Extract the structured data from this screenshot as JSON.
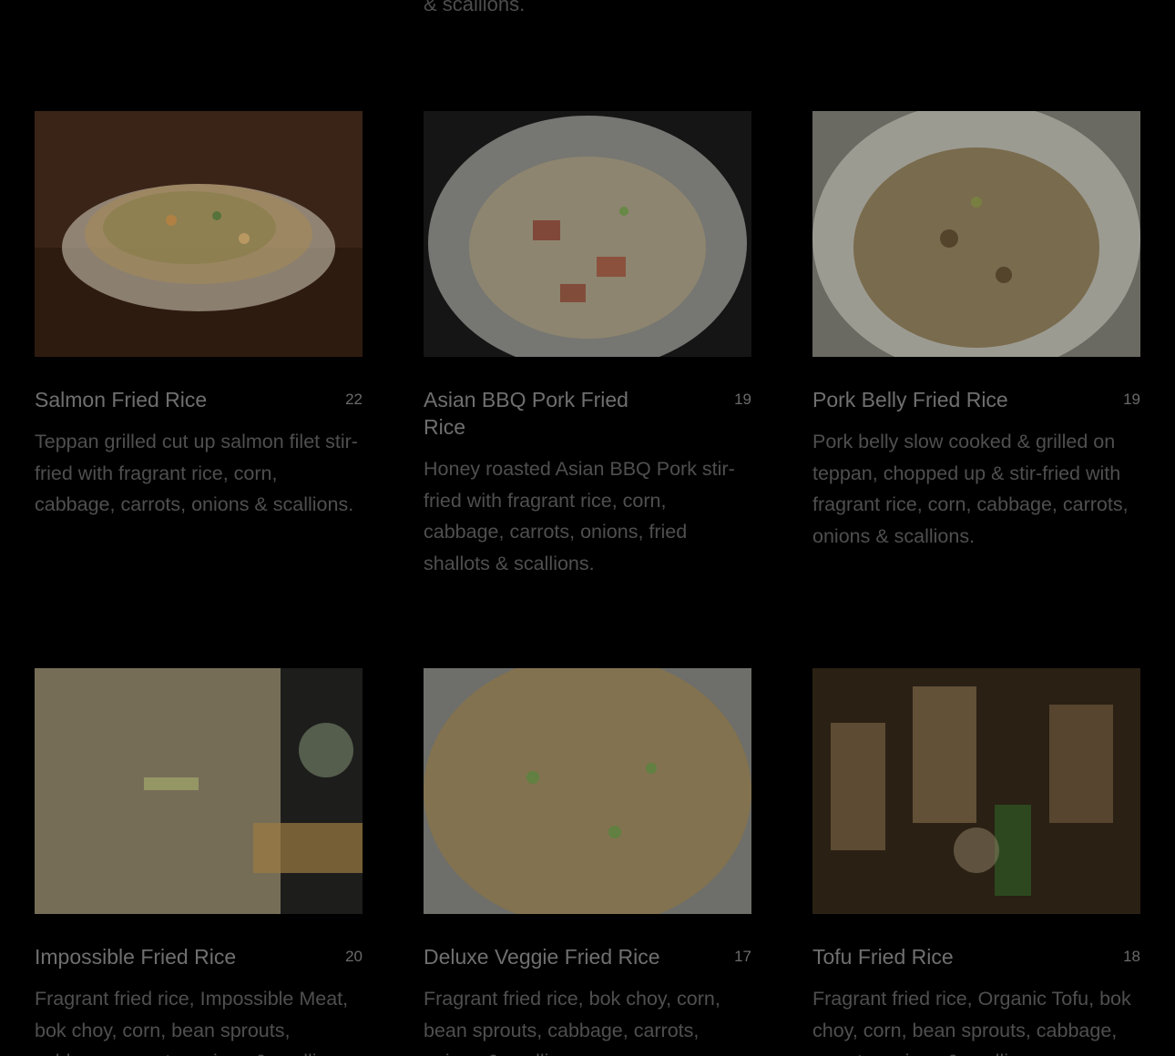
{
  "top_fragment": "& scallions.",
  "items": [
    {
      "name": "Salmon Fried Rice",
      "price": "22",
      "description": "Teppan grilled cut up salmon filet stir-fried with fragrant rice, corn, cabbage, carrots, onions & scallions."
    },
    {
      "name": "Asian BBQ Pork Fried Rice",
      "price": "19",
      "description": "Honey roasted Asian BBQ Pork stir-fried with fragrant rice, corn, cabbage, carrots, onions, fried shallots & scallions."
    },
    {
      "name": "Pork Belly Fried Rice",
      "price": "19",
      "description": "Pork belly slow cooked & grilled on teppan, chopped up & stir-fried with fragrant rice, corn, cabbage, carrots, onions & scallions."
    },
    {
      "name": "Impossible Fried Rice",
      "price": "20",
      "description": "Fragrant fried rice, Impossible Meat, bok choy, corn, bean sprouts, cabbage, carrots, onions & scallions."
    },
    {
      "name": "Deluxe Veggie Fried Rice",
      "price": "17",
      "description": "Fragrant fried rice, bok choy, corn, bean sprouts, cabbage, carrots, onions & scallions."
    },
    {
      "name": "Tofu Fried Rice",
      "price": "18",
      "description": "Fragrant fried rice, Organic Tofu, bok choy, corn, bean sprouts, cabbage, carrots, onions & scallions."
    }
  ]
}
